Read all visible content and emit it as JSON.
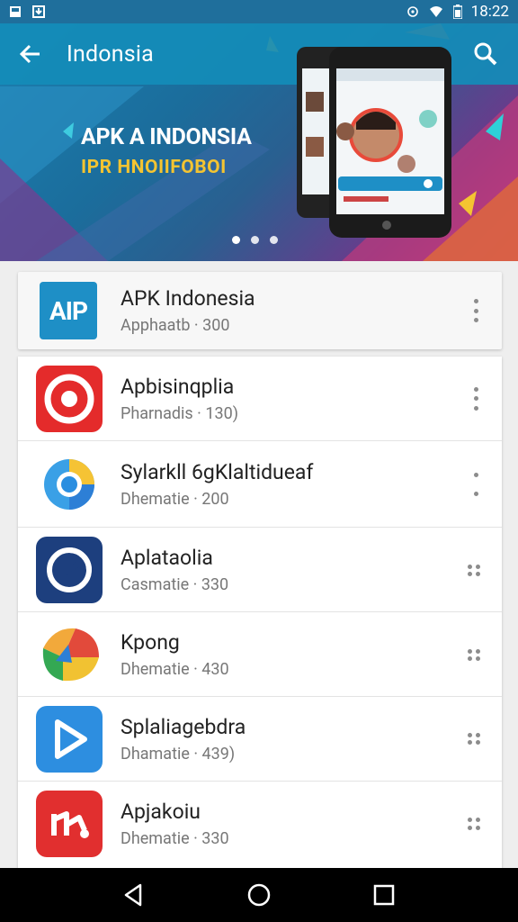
{
  "status_bar": {
    "time": "18:22",
    "icons": [
      "sim-card-icon",
      "download-icon",
      "sync-icon",
      "wifi-icon",
      "battery-icon"
    ]
  },
  "toolbar": {
    "title": "Indonsia",
    "back_icon": "arrow-back-icon",
    "search_icon": "search-icon"
  },
  "hero": {
    "headline": "APK A INDONSIA",
    "subhead": "IPR HNOIIFOBOI",
    "page_count": 3,
    "active_page": 1
  },
  "featured": {
    "icon_text": "AIP",
    "name": "APK Indonesia",
    "meta": "Apphaatb · 300"
  },
  "apps": [
    {
      "name": "Apbisinqplia",
      "meta": "Pharnadis · 130)",
      "icon": "target-icon"
    },
    {
      "name": "Sylarkll 6gKlaltidueaf",
      "meta": "Dhematie · 200",
      "icon": "chrome-like-icon"
    },
    {
      "name": "Aplataolia",
      "meta": "Casmatie · 330",
      "icon": "clock-icon"
    },
    {
      "name": "Kpong",
      "meta": "Dhematie · 430",
      "icon": "maps-like-icon"
    },
    {
      "name": "Splaliagebdra",
      "meta": "Dhamatie · 439)",
      "icon": "play-icon"
    },
    {
      "name": "Apjakoiu",
      "meta": "Dhematie · 330",
      "icon": "tool-icon"
    }
  ],
  "navbar": {
    "back": "nav-back-icon",
    "home": "nav-home-icon",
    "recents": "nav-recents-icon"
  },
  "colors": {
    "accent": "#1e8fc6",
    "toolbar": "#148cb9",
    "highlight": "#f4c431"
  }
}
